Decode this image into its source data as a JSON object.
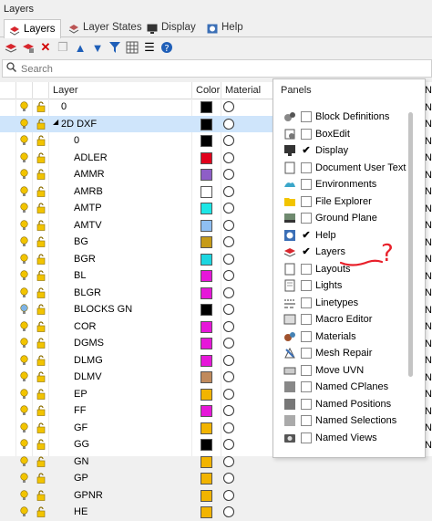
{
  "window": {
    "title": "Layers"
  },
  "tabs": [
    {
      "label": "Layers",
      "icon": "layers-icon"
    },
    {
      "label": "Layer States",
      "icon": "layer-states-icon"
    },
    {
      "label": "Display",
      "icon": "display-icon"
    },
    {
      "label": "Help",
      "icon": "help-icon"
    }
  ],
  "toolbar": {
    "icons": [
      "new-layer-icon",
      "new-sublayer-icon",
      "delete-icon",
      "copy-icon",
      "move-up-icon",
      "move-down-icon",
      "filter-icon",
      "columns-icon",
      "menu-icon",
      "help-icon"
    ]
  },
  "search": {
    "placeholder": "Search"
  },
  "columns": {
    "layer": "Layer",
    "color": "Color",
    "material": "Material"
  },
  "layers": [
    {
      "name": "0",
      "color": "#000000",
      "indent": 0,
      "selected": false
    },
    {
      "name": "2D DXF",
      "color": "#000000",
      "indent": 0,
      "selected": true,
      "expand": "◢"
    },
    {
      "name": "0",
      "color": "#000000",
      "indent": 1,
      "selected": false
    },
    {
      "name": "ADLER",
      "color": "#e0001b",
      "indent": 1,
      "selected": false
    },
    {
      "name": "AMMR",
      "color": "#8e5ec7",
      "indent": 1,
      "selected": false
    },
    {
      "name": "AMRB",
      "color": "#ffffff",
      "indent": 1,
      "selected": false
    },
    {
      "name": "AMTP",
      "color": "#1de6e6",
      "indent": 1,
      "selected": false
    },
    {
      "name": "AMTV",
      "color": "#8fbff3",
      "indent": 1,
      "selected": false
    },
    {
      "name": "BG",
      "color": "#c69b18",
      "indent": 1,
      "selected": false
    },
    {
      "name": "BGR",
      "color": "#1dd6e0",
      "indent": 1,
      "selected": false
    },
    {
      "name": "BL",
      "color": "#e617d9",
      "indent": 1,
      "selected": false
    },
    {
      "name": "BLGR",
      "color": "#e617d9",
      "indent": 1,
      "selected": false
    },
    {
      "name": "BLOCKS GN",
      "color": "#000000",
      "indent": 1,
      "selected": false
    },
    {
      "name": "COR",
      "color": "#e617d9",
      "indent": 1,
      "selected": false
    },
    {
      "name": "DGMS",
      "color": "#e617d9",
      "indent": 1,
      "selected": false
    },
    {
      "name": "DLMG",
      "color": "#e617d9",
      "indent": 1,
      "selected": false
    },
    {
      "name": "DLMV",
      "color": "#c08a5c",
      "indent": 1,
      "selected": false
    },
    {
      "name": "EP",
      "color": "#f2b400",
      "indent": 1,
      "selected": false
    },
    {
      "name": "FF",
      "color": "#e617d9",
      "indent": 1,
      "selected": false
    },
    {
      "name": "GF",
      "color": "#f2b400",
      "indent": 1,
      "selected": false
    },
    {
      "name": "GG",
      "color": "#000000",
      "indent": 1,
      "selected": false
    },
    {
      "name": "GN",
      "color": "#f2b400",
      "indent": 1,
      "selected": false
    },
    {
      "name": "GP",
      "color": "#f2b400",
      "indent": 1,
      "selected": false
    },
    {
      "name": "GPNR",
      "color": "#f2b400",
      "indent": 1,
      "selected": false
    },
    {
      "name": "HE",
      "color": "#f2b400",
      "indent": 1,
      "selected": false
    }
  ],
  "panels_menu": {
    "title": "Panels",
    "items": [
      {
        "label": "Block Definitions",
        "checked": false,
        "icon": "block-definitions-icon"
      },
      {
        "label": "BoxEdit",
        "checked": false,
        "icon": "boxedit-icon"
      },
      {
        "label": "Display",
        "checked": true,
        "icon": "display-icon"
      },
      {
        "label": "Document User Text",
        "checked": false,
        "icon": "document-user-text-icon"
      },
      {
        "label": "Environments",
        "checked": false,
        "icon": "environments-icon"
      },
      {
        "label": "File Explorer",
        "checked": false,
        "icon": "file-explorer-icon"
      },
      {
        "label": "Ground Plane",
        "checked": false,
        "icon": "ground-plane-icon"
      },
      {
        "label": "Help",
        "checked": true,
        "icon": "help-icon"
      },
      {
        "label": "Layers",
        "checked": true,
        "icon": "layers-icon"
      },
      {
        "label": "Layouts",
        "checked": false,
        "icon": "layouts-icon"
      },
      {
        "label": "Lights",
        "checked": false,
        "icon": "lights-icon"
      },
      {
        "label": "Linetypes",
        "checked": false,
        "icon": "linetypes-icon"
      },
      {
        "label": "Macro Editor",
        "checked": false,
        "icon": "macro-editor-icon"
      },
      {
        "label": "Materials",
        "checked": false,
        "icon": "materials-icon"
      },
      {
        "label": "Mesh Repair",
        "checked": false,
        "icon": "mesh-repair-icon"
      },
      {
        "label": "Move UVN",
        "checked": false,
        "icon": "move-uvn-icon"
      },
      {
        "label": "Named CPlanes",
        "checked": false,
        "icon": "named-cplanes-icon"
      },
      {
        "label": "Named Positions",
        "checked": false,
        "icon": "named-positions-icon"
      },
      {
        "label": "Named Selections",
        "checked": false,
        "icon": "named-selections-icon"
      },
      {
        "label": "Named Views",
        "checked": false,
        "icon": "named-views-icon"
      }
    ]
  },
  "right_column_text": "Ne",
  "annotation": {
    "mark": "?"
  }
}
